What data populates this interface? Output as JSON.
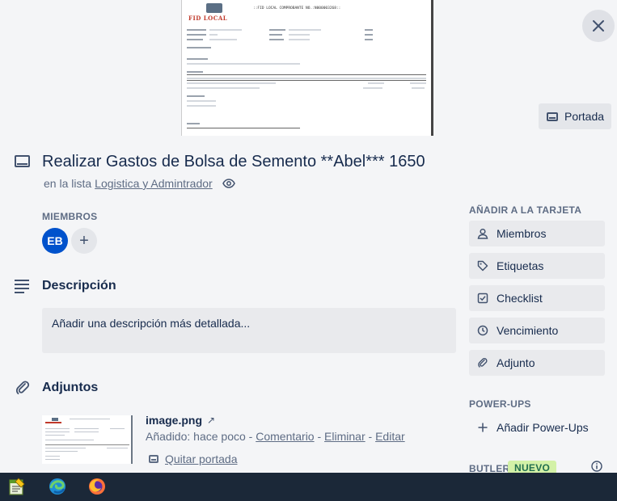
{
  "cover": {
    "doc_logo_text": "FID LOCAL",
    "doc_header_text": "::FID LOCAL COMPROBANTE NO.:N000003268::"
  },
  "close_icon": "close-icon",
  "cover_button": {
    "label": "Portada"
  },
  "card": {
    "title": "Realizar Gastos de Bolsa de Semento **Abel*** 1650",
    "list_prefix": "en la lista",
    "list_name": "Logistica y Admintrador"
  },
  "members": {
    "label": "MIEMBROS",
    "avatars": [
      {
        "initials": "EB",
        "color": "#0052cc"
      }
    ],
    "add_symbol": "+"
  },
  "description": {
    "title": "Descripción",
    "placeholder": "Añadir una descripción más detallada..."
  },
  "attachments": {
    "title": "Adjuntos",
    "items": [
      {
        "name": "image.png",
        "added": "Añadido: hace poco",
        "separator": " - ",
        "actions": [
          "Comentario",
          "Eliminar",
          "Editar"
        ],
        "remove_cover": "Quitar portada"
      }
    ]
  },
  "sidebar": {
    "add_to_card_label": "AÑADIR A LA TARJETA",
    "buttons": [
      {
        "label": "Miembros",
        "icon": "person-icon"
      },
      {
        "label": "Etiquetas",
        "icon": "tag-icon"
      },
      {
        "label": "Checklist",
        "icon": "checkbox-icon"
      },
      {
        "label": "Vencimiento",
        "icon": "clock-icon"
      },
      {
        "label": "Adjunto",
        "icon": "paperclip-icon"
      }
    ],
    "powerups_label": "POWER-UPS",
    "add_powerups": "Añadir Power-Ups",
    "butler_label": "BUTLER",
    "butler_badge": "NUEVO"
  },
  "taskbar": {
    "apps": [
      "notepad-icon",
      "edge-icon",
      "firefox-icon"
    ]
  },
  "colors": {
    "accent": "#0052cc",
    "background": "#f4f5f7",
    "button_bg": "#e9eaed",
    "badge_bg": "#d3f1a7",
    "taskbar": "#1b2838"
  }
}
